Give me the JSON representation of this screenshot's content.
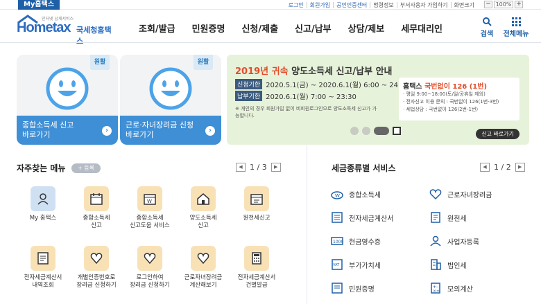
{
  "topbar": {
    "my_tab": "My홈택스",
    "utility_links": [
      "로그인",
      "회원가입",
      "공인인증센터",
      "법령정보",
      "부서사용자 가입하기",
      "화면크기"
    ],
    "zoom_minus": "−",
    "zoom_value": "100%",
    "zoom_plus": "+"
  },
  "header": {
    "logo_tagline": "인터넷 납세서비스",
    "logo_en": "Hometax",
    "logo_ko": "국세청홈택스",
    "nav": [
      "조회/발급",
      "민원증명",
      "신청/제출",
      "신고/납부",
      "상담/제보",
      "세무대리인"
    ],
    "search_label": "검색",
    "allmenu_label": "전체메뉴"
  },
  "cards": [
    {
      "badge": "원활",
      "line1": "종합소득세 신고",
      "line2": "바로가기"
    },
    {
      "badge": "원활",
      "line1": "근로·자녀장려금 신청",
      "line2": "바로가기"
    }
  ],
  "banner": {
    "title_red": "2019년 귀속",
    "title_rest": "양도소득세 신고/납부 안내",
    "row1_label": "신청기한",
    "row1_text": "2020.5.1(금) ~ 2020.6.1(월) 6:00 ~ 24:00",
    "row2_label": "납부기한",
    "row2_text": "2020.6.1(월) 7:00 ~ 23:30",
    "note": "※ 개인의 경우 회원가입 없이 비회원로그인으로 양도소득세 신고가 가능합니다.",
    "box_title": "홈택스",
    "box_title_red": "국번없이 126 (1번)",
    "box_lines": [
      "· 평일 9:00~18:00(토/일/공휴일 제외)",
      "· 전자신고 이용 문의 : 국번없이 126(1번-3번)",
      "· 세법상담 : 국번없이 126(2번-1번)"
    ],
    "cta": "신고 바로가기"
  },
  "frequent": {
    "title": "자주찾는 메뉴",
    "add_label": "+ 등록",
    "page_current": "1",
    "page_total": "3",
    "items": [
      {
        "l1": "My 홈택스",
        "l2": "",
        "icon": "person-icon"
      },
      {
        "l1": "종합소득세",
        "l2": "신고",
        "icon": "calendar-icon"
      },
      {
        "l1": "종합소득세",
        "l2": "신고도움 서비스",
        "icon": "calendar-icon"
      },
      {
        "l1": "양도소득세",
        "l2": "신고",
        "icon": "house-icon"
      },
      {
        "l1": "원천세신고",
        "l2": "",
        "icon": "calendar-icon"
      },
      {
        "l1": "전자세금계산서",
        "l2": "내역조회",
        "icon": "document-icon"
      },
      {
        "l1": "개별인증번호로",
        "l2": "장려금 신청하기",
        "icon": "heart-icon"
      },
      {
        "l1": "로그인하여",
        "l2": "장려금 신청하기",
        "icon": "heart-icon"
      },
      {
        "l1": "근로자녀장려금",
        "l2": "계산해보기",
        "icon": "heart-icon"
      },
      {
        "l1": "전자세금계산서",
        "l2": "건별발급",
        "icon": "calculator-icon"
      }
    ]
  },
  "services": {
    "title": "세금종류별 서비스",
    "page_current": "1",
    "page_total": "2",
    "items": [
      {
        "label": "종합소득세",
        "icon": "coin-icon"
      },
      {
        "label": "근로자녀장려금",
        "icon": "heart-icon"
      },
      {
        "label": "전자세금계산서",
        "icon": "document-icon"
      },
      {
        "label": "원천세",
        "icon": "receipt-icon"
      },
      {
        "label": "현금영수증",
        "icon": "cash-receipt-icon"
      },
      {
        "label": "사업자등록",
        "icon": "person-icon"
      },
      {
        "label": "부가가치세",
        "icon": "vat-icon"
      },
      {
        "label": "법인세",
        "icon": "building-icon"
      },
      {
        "label": "민원증명",
        "icon": "certificate-icon"
      },
      {
        "label": "모의계산",
        "icon": "calculator-icon"
      }
    ]
  },
  "colors": {
    "brand": "#1e5fa8",
    "card_blue": "#3f8fd6",
    "banner_bg": "#e7f2da",
    "accent_red": "#e14d2a"
  }
}
